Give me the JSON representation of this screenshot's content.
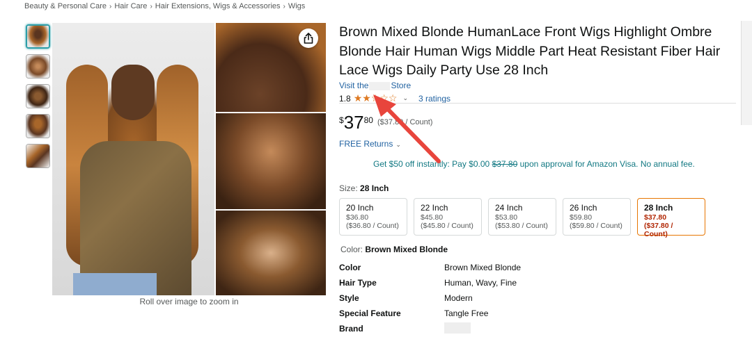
{
  "breadcrumb": [
    "Beauty & Personal Care",
    "Hair Care",
    "Hair Extensions, Wigs & Accessories",
    "Wigs"
  ],
  "breadcrumb_sep": "›",
  "gallery": {
    "zoom_hint": "Roll over image to zoom in",
    "thumb_count": 5
  },
  "product": {
    "title": "Brown Mixed Blonde HumanLace Front Wigs Highlight Ombre Blonde Hair Human Wigs Middle Part Heat Resistant Fiber Hair Lace Wigs Daily Party Use 28 Inch",
    "store_prefix": "Visit the",
    "store_suffix": "Store",
    "rating_value": "1.8",
    "stars_filled": "★★",
    "stars_empty": "☆☆☆",
    "rating_count": "3 ratings",
    "price_symbol": "$",
    "price_whole": "37",
    "price_fraction": "80",
    "price_unit": "($37.80 / Count)",
    "returns": "FREE Returns",
    "promo_text": "Get $50 off instantly: Pay $0.00 ",
    "promo_strike": "$37.80",
    "promo_suffix": " upon approval for Amazon Visa. No annual fee."
  },
  "size": {
    "label": "Size: ",
    "selected": "28 Inch",
    "options": [
      {
        "name": "20 Inch",
        "price": "$36.80",
        "unit": "($36.80 / Count)"
      },
      {
        "name": "22 Inch",
        "price": "$45.80",
        "unit": "($45.80 / Count)"
      },
      {
        "name": "24 Inch",
        "price": "$53.80",
        "unit": "($53.80 / Count)"
      },
      {
        "name": "26 Inch",
        "price": "$59.80",
        "unit": "($59.80 / Count)"
      },
      {
        "name": "28 Inch",
        "price": "$37.80",
        "unit": "($37.80 / Count)"
      }
    ]
  },
  "color": {
    "label": "Color: ",
    "selected": "Brown Mixed Blonde"
  },
  "specs": [
    {
      "key": "Color",
      "value": "Brown Mixed Blonde"
    },
    {
      "key": "Hair Type",
      "value": "Human, Wavy, Fine"
    },
    {
      "key": "Style",
      "value": "Modern"
    },
    {
      "key": "Special Feature",
      "value": "Tangle Free"
    },
    {
      "key": "Brand",
      "value": ""
    }
  ],
  "colors": {
    "link": "#2162a1",
    "star": "#de7921",
    "promo": "#117882",
    "selected_border": "#e77600",
    "selected_price": "#b12704",
    "annotation_arrow": "#e8453c"
  }
}
